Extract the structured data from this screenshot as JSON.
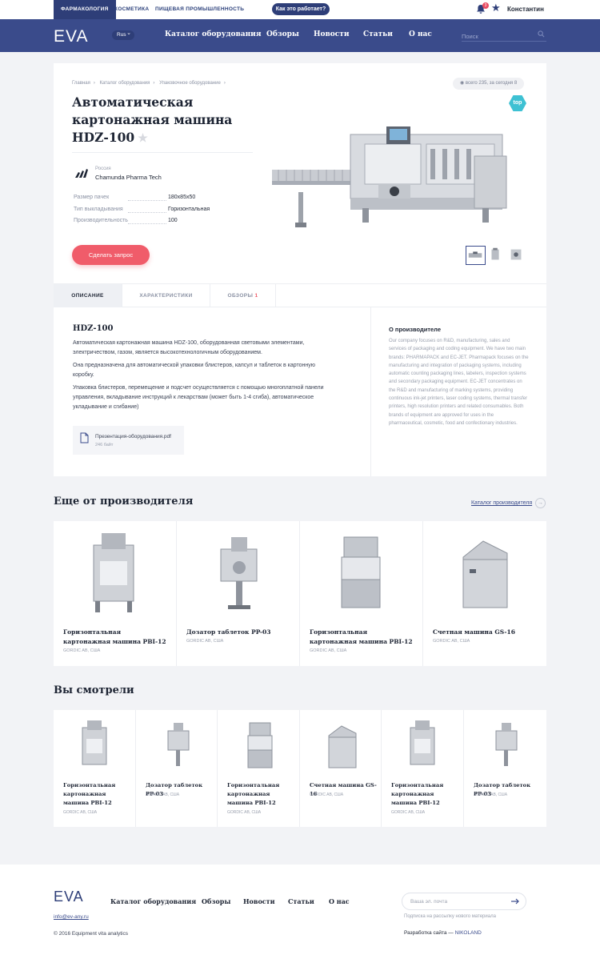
{
  "topbar": {
    "tabs": [
      "Фармакология",
      "Косметика",
      "Пищевая промышленность"
    ],
    "how_button": "Как это работает?",
    "notifications": "3",
    "user": "Константин"
  },
  "nav": {
    "logo": "EVA",
    "lang": "Rus",
    "links": [
      "Каталог оборудования",
      "Обзоры",
      "Новости",
      "Статьи",
      "О нас"
    ],
    "search_placeholder": "Поиск"
  },
  "product": {
    "breadcrumb": [
      "Главная",
      "Каталог оборудования",
      "Упаковочное оборудование"
    ],
    "count": "всего 235, за сегодня 8",
    "title": "Автоматическая картонажная машина HDZ-100",
    "badge": "top",
    "country": "Россия",
    "manufacturer": "Chamunda Pharma Tech",
    "specs": [
      {
        "key": "Размер пачек",
        "value": "180x85x50"
      },
      {
        "key": "Тип выкладывания",
        "value": "Горизонтальная"
      },
      {
        "key": "Производительность",
        "value": "100"
      }
    ],
    "cta": "Сделать запрос"
  },
  "tabs": {
    "description": "Описание",
    "specs": "Характеристики",
    "reviews": "Обзоры",
    "reviews_count": "1"
  },
  "description": {
    "heading": "HDZ-100",
    "p1": "Автоматическая картонажная машина HDZ-100, оборудованная световыми элементами, электричеством, газом, является высокотехнологичным оборудованием.",
    "p2": "Она предназначена для автоматической упаковки блистеров, капсул и таблеток в картонную коробку.",
    "p3": "Упаковка блистеров, перемещение и подсчет осуществляется с помощью многоплатной панели управления, вкладывание инструкций к лекарствам (может быть 1-4 сгиба), автоматическое укладывание и сгибание)",
    "file_name": "Презентация-оборудования.pdf",
    "file_size": "246 байт"
  },
  "about": {
    "heading": "О производителе",
    "text": "Our company focuses on R&D, manufacturing, sales and services of packaging and coding equipment. We have two main brands: PHARMAPACK and EC-JET. Pharmapack focuses on the manufacturing and integration of packaging systems, including automatic counting packaging lines, labelers, inspection systems and secondary packaging equipment. EC-JET concentrates on the R&D and manufacturing of marking systems, providing continuous ink-jet printers, laser coding systems, thermal transfer printers, high resolution printers and related consumables. Both brands of equipment are approved for uses in the pharmaceutical, cosmetic, food and confectionary industries."
  },
  "more": {
    "heading": "Еще от производителя",
    "catalog_link": "Каталог производителя",
    "items": [
      {
        "name": "Горизонтальная картонажная машина PBI-12",
        "maker": "GORDIC AB, США"
      },
      {
        "name": "Дозатор таблеток PP-03",
        "maker": "GORDIC AB, США"
      },
      {
        "name": "Горизонтальная картонажная машина PBI-12",
        "maker": "GORDIC AB, США"
      },
      {
        "name": "Счетная машина GS-16",
        "maker": "GORDIC AB, США"
      }
    ]
  },
  "seen": {
    "heading": "Вы смотрели",
    "items": [
      {
        "name": "Горизонтальная картонажная машина PBI-12",
        "maker": "GORDIC AB, США"
      },
      {
        "name": "Дозатор таблеток PP-03",
        "maker": "GORDIC AB, США"
      },
      {
        "name": "Горизонтальная картонажная машина PBI-12",
        "maker": "GORDIC AB, США"
      },
      {
        "name": "Счетная машина GS-16",
        "maker": "GORDIC AB, США"
      },
      {
        "name": "Горизонтальная картонажная машина PBI-12",
        "maker": "GORDIC AB, США"
      },
      {
        "name": "Дозатор таблеток PP-03",
        "maker": "GORDIC AB, США"
      }
    ]
  },
  "footer": {
    "logo": "EVA",
    "links": [
      "Каталог оборудования",
      "Обзоры",
      "Новости",
      "Статьи",
      "О нас"
    ],
    "email": "info@ev-any.ru",
    "copyright": "© 2016 Equipment vita analytics",
    "subscribe_placeholder": "Ваша эл. почта",
    "subscribe_note": "Подписка на рассылку нового материала",
    "dev_label": "Разработка сайта —",
    "dev_name": "NIKOLAND"
  }
}
